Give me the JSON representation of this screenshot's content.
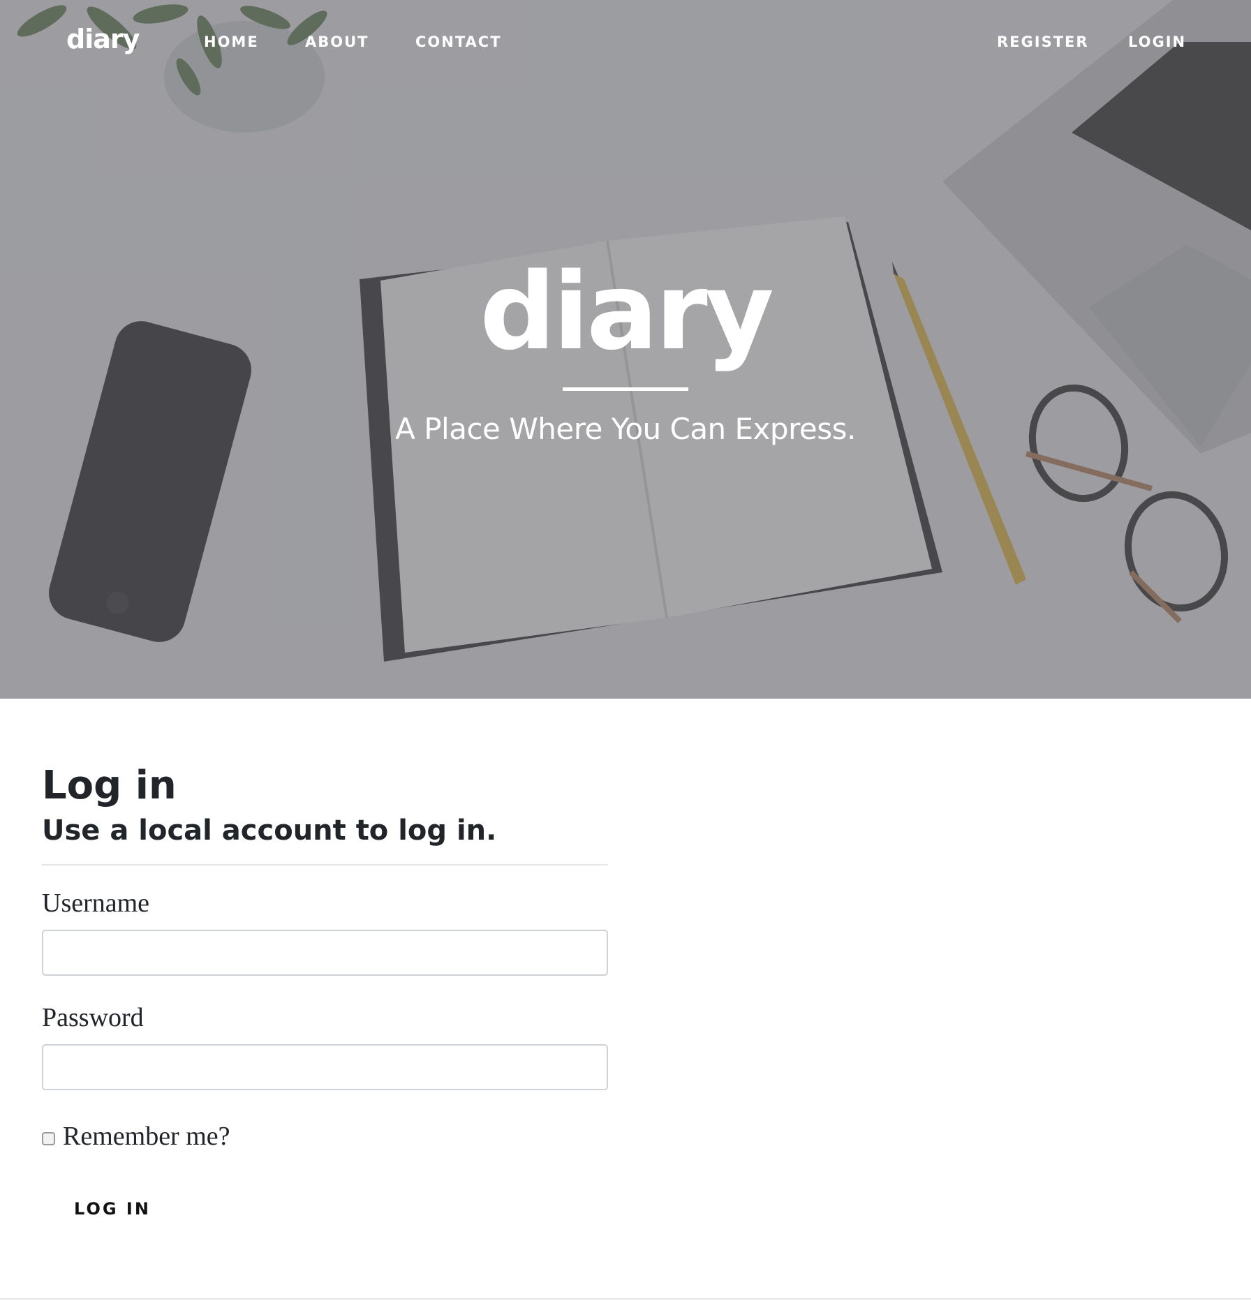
{
  "navbar": {
    "brand": "diary",
    "links": {
      "home": "HOME",
      "about": "ABOUT",
      "contact": "CONTACT",
      "register": "REGISTER",
      "login": "LOGIN"
    }
  },
  "hero": {
    "title": "diary",
    "subtitle": "A Place Where You Can Express."
  },
  "login_form": {
    "title": "Log in",
    "subtitle": "Use a local account to log in.",
    "username_label": "Username",
    "username_value": "",
    "password_label": "Password",
    "password_value": "",
    "remember_label": "Remember me?",
    "remember_checked": false,
    "submit_label": "LOG IN"
  },
  "colors": {
    "text_dark": "#212529",
    "hero_text": "#ffffff",
    "input_border": "#cfd2d6"
  }
}
